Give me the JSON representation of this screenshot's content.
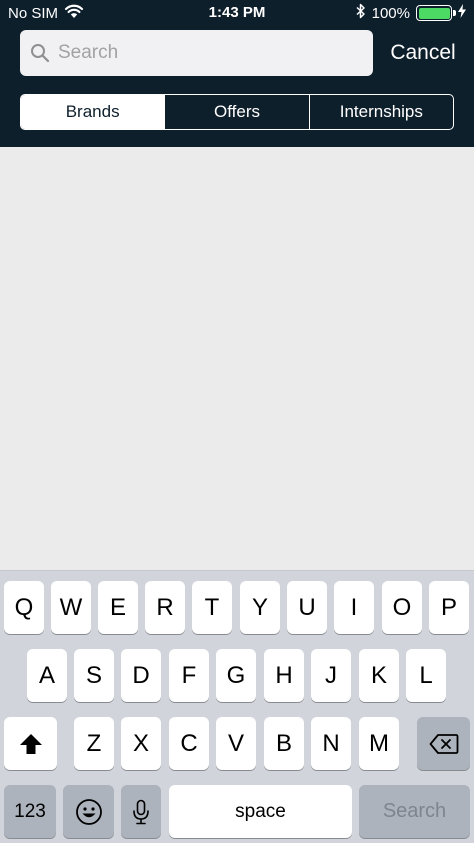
{
  "status_bar": {
    "carrier": "No SIM",
    "time": "1:43 PM",
    "battery_percent": "100%",
    "battery_level": 1.0,
    "battery_color": "#4cd964"
  },
  "search": {
    "placeholder": "Search",
    "value": "",
    "cancel_label": "Cancel"
  },
  "tabs": [
    {
      "label": "Brands",
      "active": true
    },
    {
      "label": "Offers",
      "active": false
    },
    {
      "label": "Internships",
      "active": false
    }
  ],
  "colors": {
    "header_bg": "#0e1f2c",
    "content_bg": "#ebebeb",
    "keyboard_bg": "#d1d5db"
  },
  "keyboard": {
    "row1": [
      "Q",
      "W",
      "E",
      "R",
      "T",
      "Y",
      "U",
      "I",
      "O",
      "P"
    ],
    "row2": [
      "A",
      "S",
      "D",
      "F",
      "G",
      "H",
      "J",
      "K",
      "L"
    ],
    "row3": [
      "Z",
      "X",
      "C",
      "V",
      "B",
      "N",
      "M"
    ],
    "numbers_label": "123",
    "space_label": "space",
    "search_label": "Search",
    "icons": {
      "shift": "shift-icon",
      "delete": "delete-icon",
      "emoji": "emoji-icon",
      "mic": "microphone-icon"
    }
  }
}
